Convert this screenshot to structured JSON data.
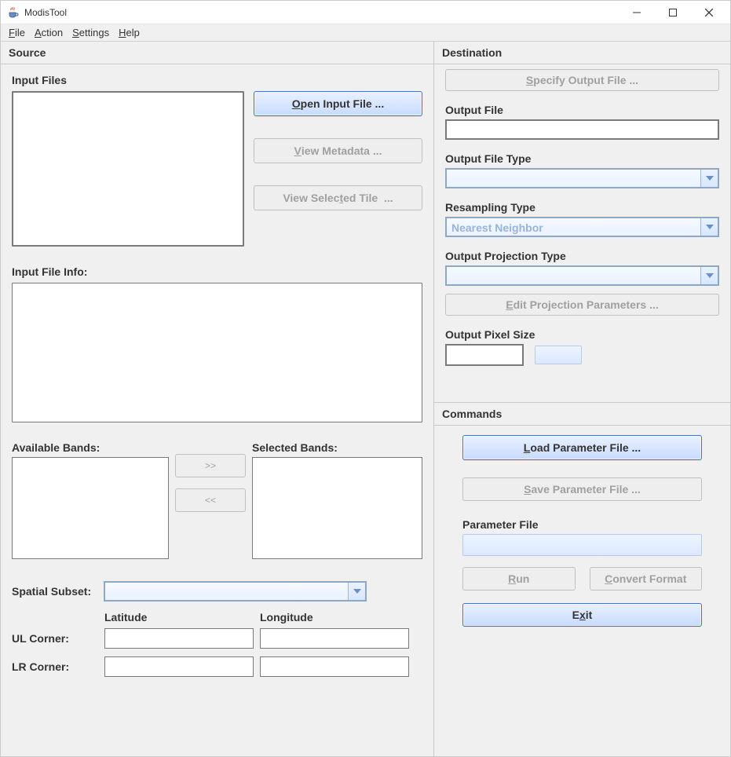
{
  "window": {
    "title": "ModisTool"
  },
  "menu": {
    "file": "File",
    "action": "Action",
    "settings": "Settings",
    "help": "Help"
  },
  "source": {
    "header": "Source",
    "input_files_label": "Input Files",
    "open_input_file": "Open Input File ...",
    "view_metadata": "View Metadata ...",
    "view_selected_tile": "View Selected Tile  ...",
    "input_file_info_label": "Input File Info:",
    "available_bands_label": "Available Bands:",
    "selected_bands_label": "Selected Bands:",
    "move_right": ">>",
    "move_left": "<<",
    "spatial_subset_label": "Spatial Subset:",
    "spatial_subset_value": "",
    "latitude_label": "Latitude",
    "longitude_label": "Longitude",
    "ul_corner_label": "UL Corner:",
    "lr_corner_label": "LR Corner:"
  },
  "destination": {
    "header": "Destination",
    "specify_output_file": "Specify Output File ...",
    "output_file_label": "Output File",
    "output_file_value": "",
    "output_file_type_label": "Output File Type",
    "output_file_type_value": "",
    "resampling_type_label": "Resampling Type",
    "resampling_type_value": "Nearest Neighbor",
    "output_projection_label": "Output Projection Type",
    "output_projection_value": "",
    "edit_projection_params": "Edit Projection Parameters ...",
    "output_pixel_size_label": "Output Pixel Size",
    "output_pixel_size_value": ""
  },
  "commands": {
    "header": "Commands",
    "load_parameter_file": "Load Parameter File ...",
    "save_parameter_file": "Save Parameter File ...",
    "parameter_file_label": "Parameter File",
    "parameter_file_value": "",
    "run": "Run",
    "convert_format": "Convert Format",
    "exit": "Exit"
  }
}
